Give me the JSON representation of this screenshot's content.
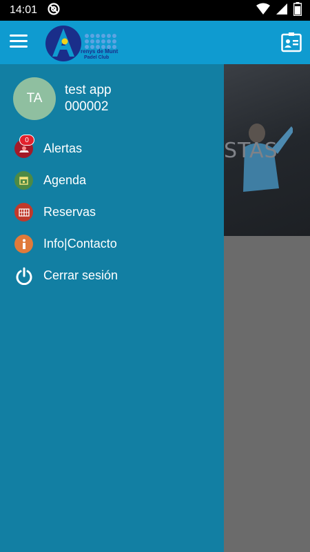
{
  "status_bar": {
    "time": "14:01"
  },
  "app_bar": {
    "logo_line1": "renys de Munt",
    "logo_line2": "Padel Club"
  },
  "background": {
    "hero_text": "STAS"
  },
  "drawer": {
    "user": {
      "initials": "TA",
      "name": "test app",
      "id": "000002"
    },
    "items": [
      {
        "label": "Alertas",
        "icon": "alert-icon",
        "badge": "0",
        "color": "#c01f2e"
      },
      {
        "label": "Agenda",
        "icon": "calendar-icon",
        "color": "#4d8a45"
      },
      {
        "label": "Reservas",
        "icon": "court-icon",
        "color": "#c0392b"
      },
      {
        "label": "Info|Contacto",
        "icon": "info-icon",
        "color": "#e07a3a"
      },
      {
        "label": "Cerrar sesión",
        "icon": "power-icon",
        "color": ""
      }
    ]
  },
  "colors": {
    "app_bar": "#0f9bd0",
    "drawer": "#127fa3",
    "avatar": "#8fbfa0"
  }
}
